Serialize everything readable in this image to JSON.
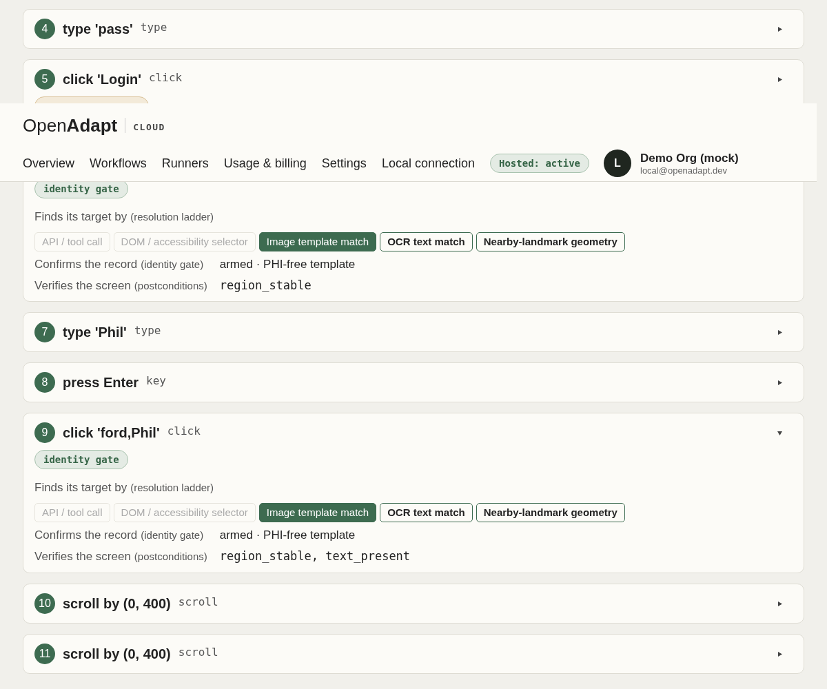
{
  "header": {
    "logo": "Open**Adapt**",
    "product": "CLOUD",
    "nav": [
      {
        "label": "Overview"
      },
      {
        "label": "Workflows"
      },
      {
        "label": "Runners"
      },
      {
        "label": "Usage & billing"
      },
      {
        "label": "Settings"
      },
      {
        "label": "Local connection"
      }
    ],
    "status": "Hosted: active",
    "avatar": "L",
    "org": "Demo Org (mock)",
    "email": "local@openadapt.dev"
  },
  "steps": [
    {
      "number": "4",
      "title": "type 'pass'",
      "action": "type",
      "expanded": false
    },
    {
      "number": "5",
      "title": "click 'Login'",
      "action": "click",
      "expanded": false,
      "badge": {
        "color": "#d8c096"
      }
    },
    {
      "badge": {
        "color": "#a8c2ae",
        "label": "identity gate"
      },
      "details": {
        "finds_label": "Finds its target by",
        "finds_note": "(resolution ladder)",
        "ladder": [
          {
            "label": "API / tool call",
            "kind": "unavailable"
          },
          {
            "label": "DOM / accessibility selector",
            "kind": "unavailable"
          },
          {
            "label": "Image template match",
            "kind": "chosen"
          },
          {
            "label": "OCR text match",
            "kind": "fallback"
          },
          {
            "label": "Nearby-landmark geometry",
            "kind": "fallback"
          }
        ],
        "confirms_label": "Confirms the record",
        "confirms_note": "(identity gate)",
        "confirms_value": "armed · PHI-free template",
        "verifies_label": "Verifies the screen",
        "verifies_note": "(postconditions)",
        "verifies_value": "region_stable"
      }
    },
    {
      "number": "7",
      "title": "type 'Phil'",
      "action": "type",
      "expanded": false
    },
    {
      "number": "8",
      "title": "press Enter",
      "action": "key",
      "expanded": false
    },
    {
      "number": "9",
      "title": "click 'ford,Phil'",
      "action": "click",
      "expanded": true,
      "badge": {
        "color": "#a8c2ae",
        "label": "identity gate"
      },
      "details": {
        "finds_label": "Finds its target by",
        "finds_note": "(resolution ladder)",
        "ladder": [
          {
            "label": "API / tool call",
            "kind": "unavailable"
          },
          {
            "label": "DOM / accessibility selector",
            "kind": "unavailable"
          },
          {
            "label": "Image template match",
            "kind": "chosen"
          },
          {
            "label": "OCR text match",
            "kind": "fallback"
          },
          {
            "label": "Nearby-landmark geometry",
            "kind": "fallback"
          }
        ],
        "confirms_label": "Confirms the record",
        "confirms_note": "(identity gate)",
        "confirms_value": "armed · PHI-free template",
        "verifies_label": "Verifies the screen",
        "verifies_note": "(postconditions)",
        "verifies_value": "region_stable, text_present"
      }
    },
    {
      "number": "10",
      "title": "scroll by (0, 400)",
      "action": "scroll",
      "expanded": false
    },
    {
      "number": "11",
      "title": "scroll by (0, 400)",
      "action": "scroll",
      "expanded": false
    }
  ]
}
